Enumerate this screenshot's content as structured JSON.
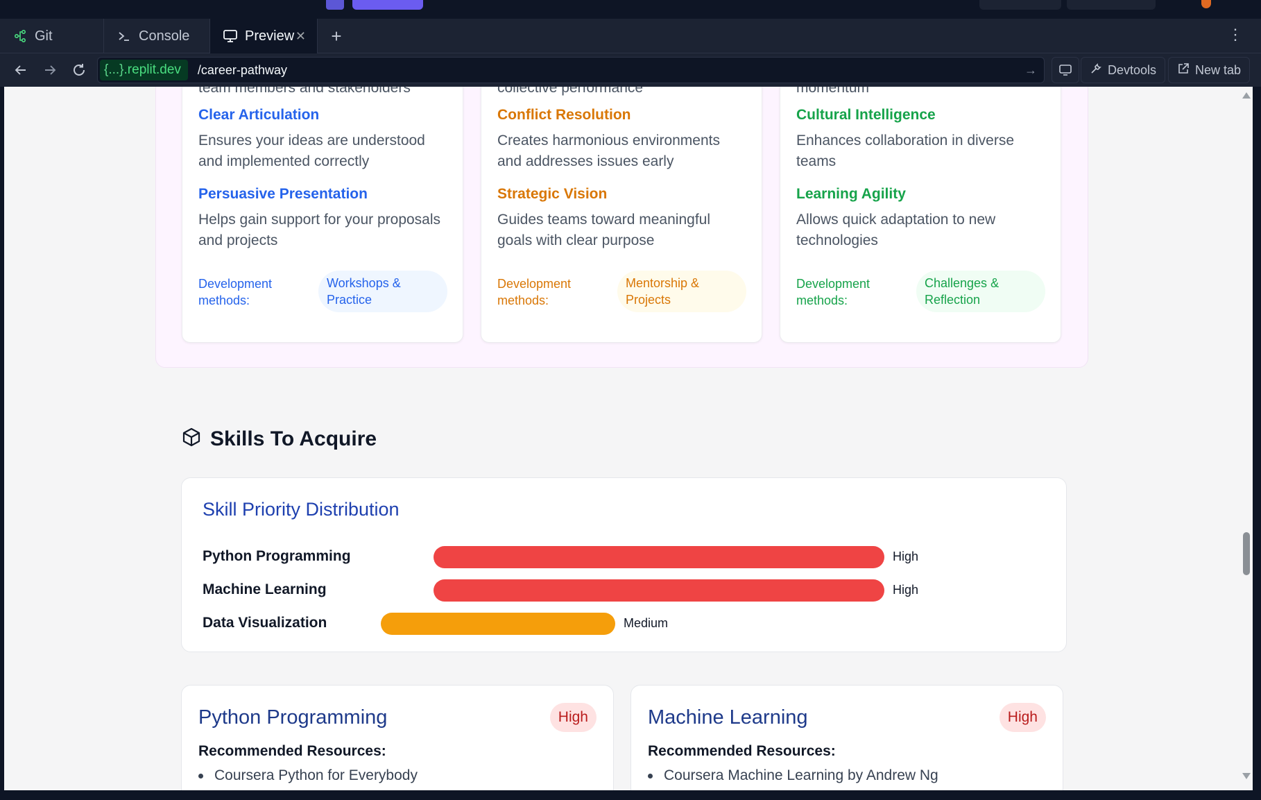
{
  "tabs": [
    {
      "label": "Git",
      "icon": "git-branch-icon"
    },
    {
      "label": "Console",
      "icon": "terminal-icon"
    },
    {
      "label": "Preview",
      "icon": "monitor-icon",
      "active": true
    }
  ],
  "addressbar": {
    "domain_braces": "{...}",
    "domain": ".replit.dev",
    "path": "/career-pathway",
    "devtools_label": "Devtools",
    "newtab_label": "New tab"
  },
  "skill_columns": [
    {
      "theme": "blue",
      "lead_text": "team members and stakeholders",
      "items": [
        {
          "title": "Clear Articulation",
          "desc": "Ensures your ideas are understood and implemented correctly"
        },
        {
          "title": "Persuasive Presentation",
          "desc": "Helps gain support for your proposals and projects"
        }
      ],
      "dev_label": "Development methods:",
      "method": "Workshops & Practice"
    },
    {
      "theme": "orange",
      "lead_text": "collective performance",
      "items": [
        {
          "title": "Conflict Resolution",
          "desc": "Creates harmonious environments and addresses issues early"
        },
        {
          "title": "Strategic Vision",
          "desc": "Guides teams toward meaningful goals with clear purpose"
        }
      ],
      "dev_label": "Development methods:",
      "method": "Mentorship & Projects"
    },
    {
      "theme": "green",
      "lead_text": "momentum",
      "items": [
        {
          "title": "Cultural Intelligence",
          "desc": "Enhances collaboration in diverse teams"
        },
        {
          "title": "Learning Agility",
          "desc": "Allows quick adaptation to new technologies"
        }
      ],
      "dev_label": "Development methods:",
      "method": "Challenges & Reflection"
    }
  ],
  "skills_section": {
    "heading": "Skills To Acquire",
    "distribution_title": "Skill Priority Distribution",
    "priorities": [
      {
        "skill": "Python Programming",
        "level": "High",
        "fraction": 1.0,
        "color": "#ef4444"
      },
      {
        "skill": "Machine Learning",
        "level": "High",
        "fraction": 1.0,
        "color": "#ef4444"
      },
      {
        "skill": "Data Visualization",
        "level": "Medium",
        "fraction": 0.52,
        "color": "#f59e0b"
      }
    ],
    "skill_cards": [
      {
        "name": "Python Programming",
        "priority": "High",
        "resources_label": "Recommended Resources:",
        "resources": [
          "Coursera Python for Everybody"
        ]
      },
      {
        "name": "Machine Learning",
        "priority": "High",
        "resources_label": "Recommended Resources:",
        "resources": [
          "Coursera Machine Learning by Andrew Ng"
        ]
      }
    ]
  }
}
